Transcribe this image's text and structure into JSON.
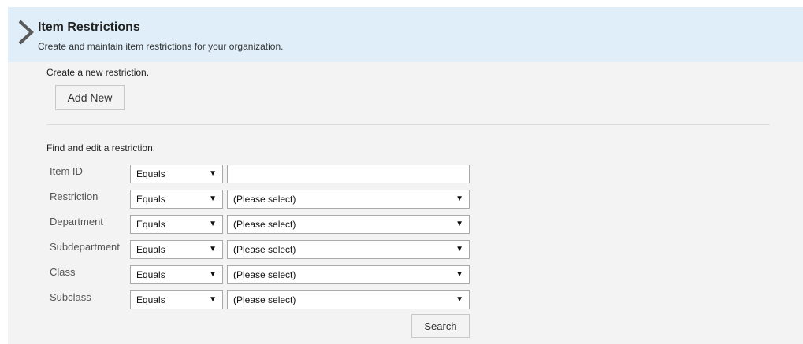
{
  "header": {
    "title": "Item Restrictions",
    "subtitle": "Create and maintain item restrictions for your organization."
  },
  "create": {
    "text": "Create a new restriction.",
    "button_label": "Add New"
  },
  "find": {
    "text": "Find and edit a restriction.",
    "rows": [
      {
        "label": "Item ID",
        "operator": "Equals",
        "value": ""
      },
      {
        "label": "Restriction",
        "operator": "Equals",
        "value": "(Please select)"
      },
      {
        "label": "Department",
        "operator": "Equals",
        "value": "(Please select)"
      },
      {
        "label": "Subdepartment",
        "operator": "Equals",
        "value": "(Please select)"
      },
      {
        "label": "Class",
        "operator": "Equals",
        "value": "(Please select)"
      },
      {
        "label": "Subclass",
        "operator": "Equals",
        "value": "(Please select)"
      }
    ],
    "search_label": "Search"
  },
  "icons": {
    "header_icon": "chevron-right-icon",
    "dropdown_arrow": "▼"
  }
}
